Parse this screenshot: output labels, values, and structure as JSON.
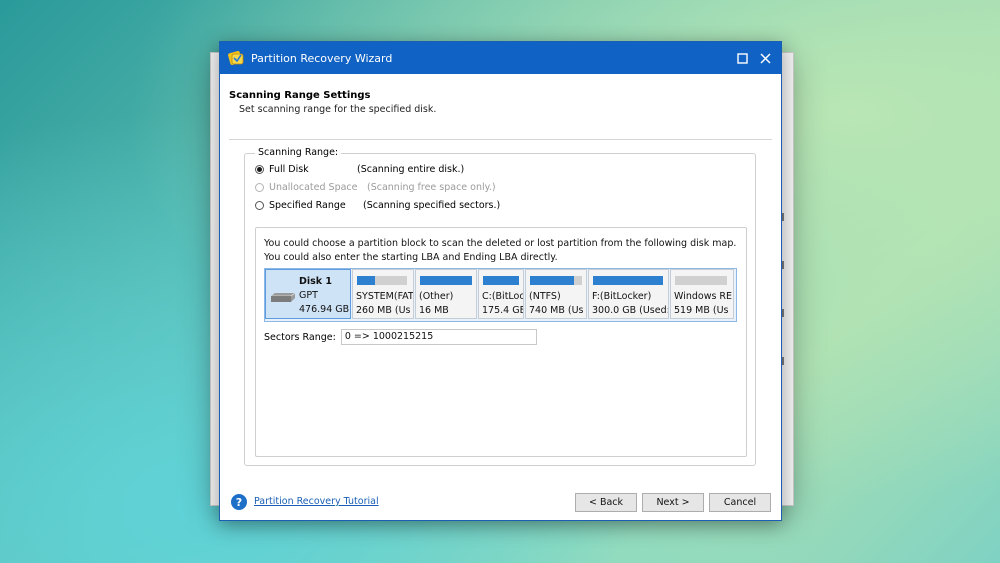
{
  "window": {
    "title": "Partition Recovery Wizard"
  },
  "header": {
    "title": "Scanning Range Settings",
    "subtitle": "Set scanning range for the specified disk."
  },
  "scan_range": {
    "legend": "Scanning Range:",
    "options": [
      {
        "label": "Full Disk",
        "description": "(Scanning entire disk.)",
        "checked": true,
        "disabled": false
      },
      {
        "label": "Unallocated Space",
        "description": "(Scanning free space only.)",
        "checked": false,
        "disabled": true
      },
      {
        "label": "Specified Range",
        "description": "(Scanning specified sectors.)",
        "checked": false,
        "disabled": false
      }
    ]
  },
  "info": {
    "line1": "You could choose a partition block to scan the deleted or lost partition from the following disk map.",
    "line2": "You could also enter the starting LBA and Ending LBA directly."
  },
  "disk": {
    "name": "Disk 1",
    "type": "GPT",
    "size": "476.94 GB"
  },
  "partitions": [
    {
      "name": "SYSTEM(FAT",
      "size": "260 MB (Us",
      "used": 0.35
    },
    {
      "name": "(Other)",
      "size": "16 MB",
      "used": 1.0
    },
    {
      "name": "C:(BitLoc",
      "size": "175.4 GE",
      "used": 1.0
    },
    {
      "name": "(NTFS)",
      "size": "740 MB (Us",
      "used": 0.85
    },
    {
      "name": "F:(BitLocker)",
      "size": "300.0 GB (Used:",
      "used": 1.0
    },
    {
      "name": "Windows RE",
      "size": "519 MB (Us",
      "used": 0.0
    }
  ],
  "sectors": {
    "label": "Sectors Range:",
    "value": "0 => 1000215215"
  },
  "footer": {
    "tutorial": "Partition Recovery Tutorial",
    "back": "< Back",
    "next": "Next >",
    "cancel": "Cancel"
  },
  "colors": {
    "titlebar": "#1062c4",
    "accent": "#2d7fd0",
    "selected": "#cfe3f7"
  }
}
